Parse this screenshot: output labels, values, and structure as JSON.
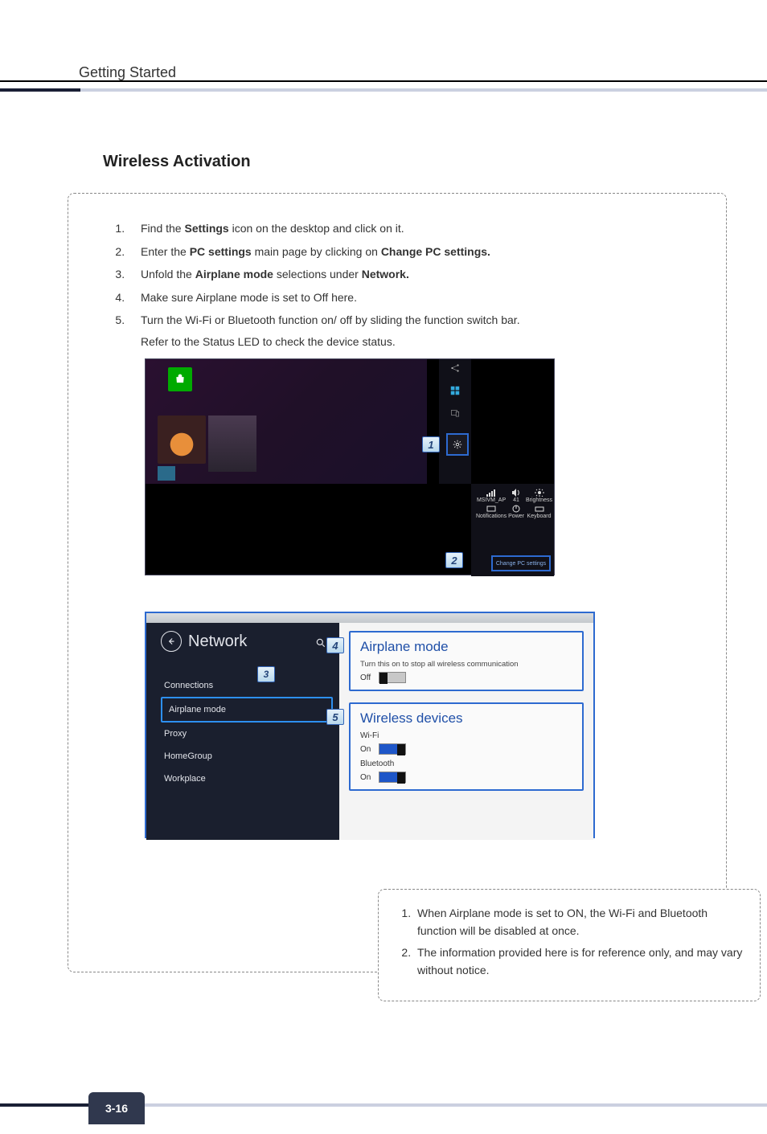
{
  "header": {
    "section": "Getting Started"
  },
  "title": "Wireless Activation",
  "steps": [
    {
      "pre": "Find the ",
      "b1": "Settings",
      "post": " icon on the desktop and click on it."
    },
    {
      "pre": "Enter the ",
      "b1": "PC settings",
      "mid": " main page by clicking on ",
      "b2": "Change PC settings.",
      "post": ""
    },
    {
      "pre": "Unfold the ",
      "b1": "Airplane mode",
      "mid": " selections under ",
      "b2": "Network.",
      "post": ""
    },
    {
      "pre": "Make sure Airplane mode is set to Off here.",
      "b1": "",
      "post": ""
    },
    {
      "pre": "Turn the Wi-Fi or Bluetooth function on/ off by sliding the function switch bar.",
      "b1": "",
      "post": ""
    }
  ],
  "step5_ref": "Refer to the Status LED to check the device status.",
  "callouts": {
    "c1": "1",
    "c2": "2",
    "c3": "3",
    "c4": "4",
    "c5": "5"
  },
  "figure1": {
    "charms": {
      "share": "Share",
      "start": "Start",
      "devices": "Devices",
      "settings": "Settings"
    },
    "settings_grid": {
      "network": "MSIVM_AP",
      "volume": "41",
      "brightness": "Brightness",
      "notifications": "Notifications",
      "power": "Power",
      "keyboard": "Keyboard"
    },
    "change_pc": "Change PC settings"
  },
  "figure2": {
    "back_title": "Network",
    "nav": {
      "connections": "Connections",
      "airplane": "Airplane mode",
      "proxy": "Proxy",
      "homegroup": "HomeGroup",
      "workplace": "Workplace"
    },
    "airplane_panel": {
      "title": "Airplane mode",
      "desc": "Turn this on to stop all wireless communication",
      "state": "Off"
    },
    "wireless_panel": {
      "title": "Wireless devices",
      "wifi_label": "Wi-Fi",
      "wifi_state": "On",
      "bt_label": "Bluetooth",
      "bt_state": "On"
    }
  },
  "notes": [
    "When Airplane mode is set to ON, the Wi-Fi and Bluetooth function will be disabled at once.",
    "The information provided here is for reference only, and may vary without notice."
  ],
  "page_number": "3-16"
}
